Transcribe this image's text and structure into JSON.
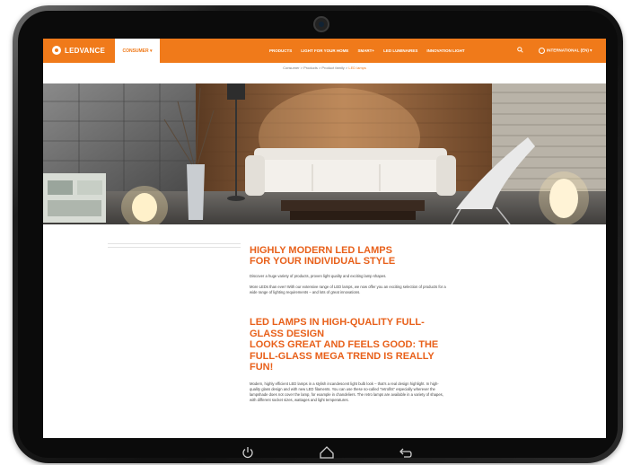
{
  "site": {
    "logo_text": "LEDVANCE",
    "consumer_tab": "CONSUMER ▾",
    "nav_links": [
      "PRODUCTS",
      "LIGHT FOR YOUR HOME",
      "SMART+",
      "LED LUMINAIRES",
      "INNOVATION LIGHT"
    ],
    "international": "INTERNATIONAL (EN) ▾"
  },
  "breadcrumb": {
    "path": "Consumer > Products > Product family > ",
    "current": "LED lamps"
  },
  "section1": {
    "title": "HIGHLY MODERN LED LAMPS",
    "subtitle": "FOR YOUR INDIVIDUAL STYLE",
    "para1": "Discover a huge variety of products, proven light quality and exciting lamp shapes.",
    "para2": "More LEDs than ever! With our extensive range of LED lamps, we now offer you an exciting selection of products for a wide range of lighting requirements – and lots of great innovations."
  },
  "section2": {
    "title": "LED LAMPS IN HIGH-QUALITY FULL-GLASS DESIGN",
    "subtitle": "LOOKS GREAT AND FEELS GOOD: THE FULL-GLASS MEGA TREND IS REALLY FUN!",
    "para": "Modern, highly efficient LED lamps in a stylish incandescent light bulb look – that's a real design highlight. In high-quality glass design and with new LED filaments. You can use these so-called \"retrofits\" especially wherever the lampshade does not cover the lamp, for example in chandeliers. The retro lamps are available in a variety of shapes, with different socket sizes, wattages and light temperatures."
  },
  "colors": {
    "brand_orange": "#f07a1a",
    "heading_orange": "#e8601a"
  },
  "icons": {
    "search": "search-icon",
    "globe": "globe-icon",
    "power": "power-icon",
    "home": "home-icon",
    "back": "back-icon"
  }
}
